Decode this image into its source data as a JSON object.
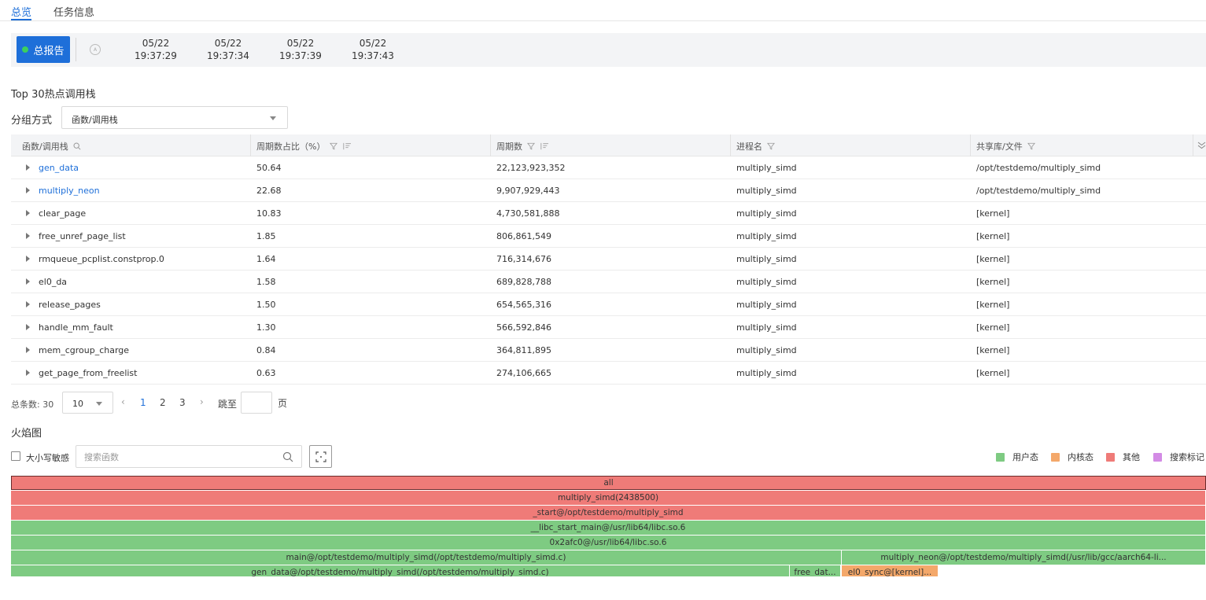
{
  "tabs": [
    {
      "label": "总览",
      "active": true
    },
    {
      "label": "任务信息",
      "active": false
    }
  ],
  "timeline": {
    "report_button": "总报告",
    "ticks": [
      {
        "date": "05/22",
        "time": "19:37:29"
      },
      {
        "date": "05/22",
        "time": "19:37:34"
      },
      {
        "date": "05/22",
        "time": "19:37:39"
      },
      {
        "date": "05/22",
        "time": "19:37:43"
      }
    ]
  },
  "hotspot": {
    "title": "Top 30热点调用栈",
    "group_by_label": "分组方式",
    "group_by_value": "函数/调用栈",
    "columns": [
      "函数/调用栈",
      "周期数占比（%）",
      "周期数",
      "进程名",
      "共享库/文件"
    ],
    "rows": [
      {
        "func": "gen_data",
        "pct": "50.64",
        "cycles": "22,123,923,352",
        "process": "multiply_simd",
        "lib": "/opt/testdemo/multiply_simd",
        "link": true
      },
      {
        "func": "multiply_neon",
        "pct": "22.68",
        "cycles": "9,907,929,443",
        "process": "multiply_simd",
        "lib": "/opt/testdemo/multiply_simd",
        "link": true
      },
      {
        "func": "clear_page",
        "pct": "10.83",
        "cycles": "4,730,581,888",
        "process": "multiply_simd",
        "lib": "[kernel]",
        "link": false
      },
      {
        "func": "free_unref_page_list",
        "pct": "1.85",
        "cycles": "806,861,549",
        "process": "multiply_simd",
        "lib": "[kernel]",
        "link": false
      },
      {
        "func": "rmqueue_pcplist.constprop.0",
        "pct": "1.64",
        "cycles": "716,314,676",
        "process": "multiply_simd",
        "lib": "[kernel]",
        "link": false
      },
      {
        "func": "el0_da",
        "pct": "1.58",
        "cycles": "689,828,788",
        "process": "multiply_simd",
        "lib": "[kernel]",
        "link": false
      },
      {
        "func": "release_pages",
        "pct": "1.50",
        "cycles": "654,565,316",
        "process": "multiply_simd",
        "lib": "[kernel]",
        "link": false
      },
      {
        "func": "handle_mm_fault",
        "pct": "1.30",
        "cycles": "566,592,846",
        "process": "multiply_simd",
        "lib": "[kernel]",
        "link": false
      },
      {
        "func": "mem_cgroup_charge",
        "pct": "0.84",
        "cycles": "364,811,895",
        "process": "multiply_simd",
        "lib": "[kernel]",
        "link": false
      },
      {
        "func": "get_page_from_freelist",
        "pct": "0.63",
        "cycles": "274,106,665",
        "process": "multiply_simd",
        "lib": "[kernel]",
        "link": false
      }
    ]
  },
  "pagination": {
    "total_label": "总条数: 30",
    "page_size": "10",
    "pages": [
      "1",
      "2",
      "3"
    ],
    "current_page": "1",
    "jump_label": "跳至",
    "unit_label": "页"
  },
  "flame": {
    "title": "火焰图",
    "case_sensitive_label": "大小写敏感",
    "search_placeholder": "搜索函数",
    "legend": [
      {
        "label": "用户态",
        "color": "#7ecb82"
      },
      {
        "label": "内核态",
        "color": "#f4a86a"
      },
      {
        "label": "其他",
        "color": "#ef7b78"
      },
      {
        "label": "搜索标记",
        "color": "#d38be5"
      }
    ],
    "colors": {
      "user": "#7ecb82",
      "kernel": "#f4a86a",
      "other": "#ef7b78"
    },
    "frames": [
      {
        "label": "all",
        "type": "other",
        "level": 0,
        "start": 0.0,
        "share": 1.0
      },
      {
        "label": "multiply_simd(2438500)",
        "type": "other",
        "level": 1,
        "start": 0.0,
        "share": 1.0
      },
      {
        "label": "_start@/opt/testdemo/multiply_simd",
        "type": "other",
        "level": 2,
        "start": 0.0,
        "share": 1.0
      },
      {
        "label": "__libc_start_main@/usr/lib64/libc.so.6",
        "type": "user",
        "level": 3,
        "start": 0.0,
        "share": 1.0
      },
      {
        "label": "0x2afc0@/usr/lib64/libc.so.6",
        "type": "user",
        "level": 4,
        "start": 0.0,
        "share": 1.0
      },
      {
        "label": "main@/opt/testdemo/multiply_simd(/opt/testdemo/multiply_simd.c)",
        "type": "user",
        "level": 5,
        "start": 0.0,
        "share": 0.695
      },
      {
        "label": "multiply_neon@/opt/testdemo/multiply_simd(/usr/lib/gcc/aarch64-li...",
        "type": "user",
        "level": 5,
        "start": 0.695,
        "share": 0.305
      },
      {
        "label": "gen_data@/opt/testdemo/multiply_simd(/opt/testdemo/multiply_simd.c)",
        "type": "user",
        "level": 6,
        "start": 0.0,
        "share": 0.652
      },
      {
        "label": "free_dat...",
        "type": "user",
        "level": 6,
        "start": 0.652,
        "share": 0.043
      },
      {
        "label": "el0_sync@[kernel]...",
        "type": "kernel",
        "level": 6,
        "start": 0.695,
        "share": 0.081
      }
    ]
  }
}
